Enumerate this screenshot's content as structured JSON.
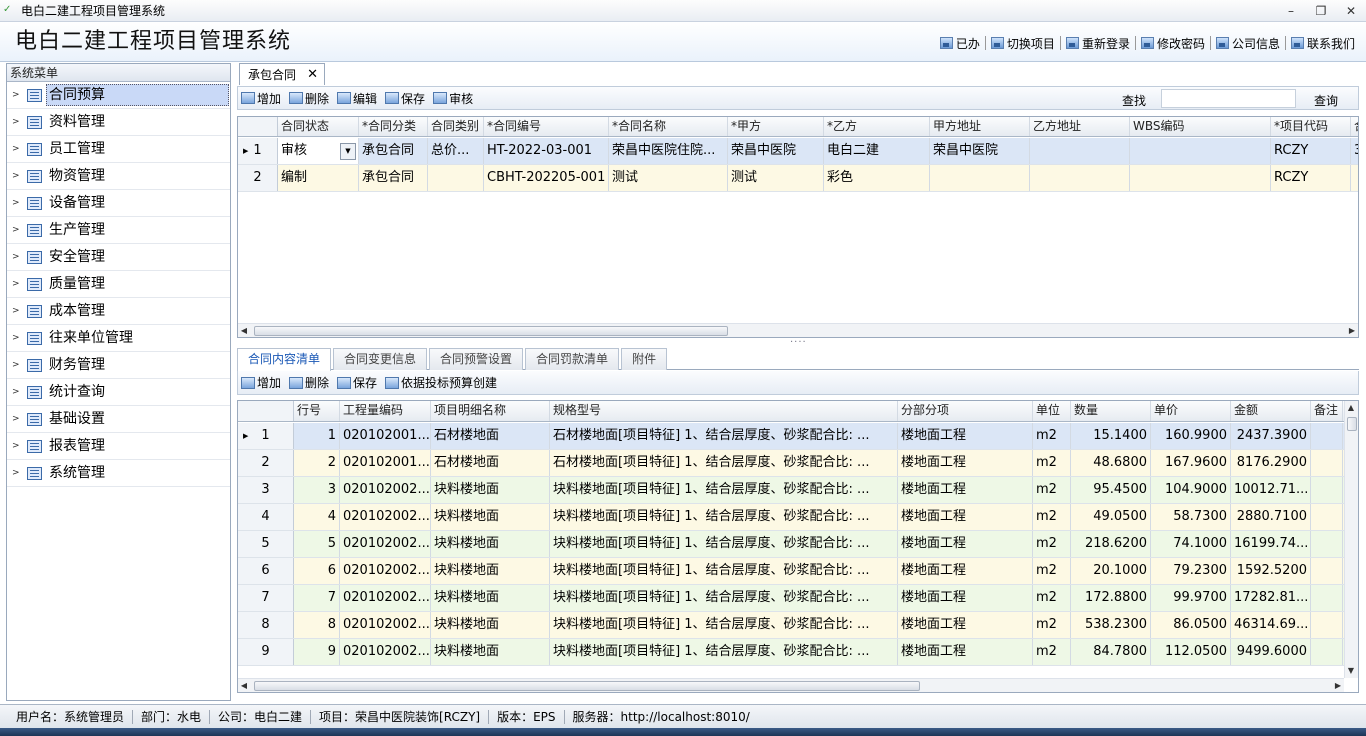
{
  "window": {
    "title": "电白二建工程项目管理系统"
  },
  "header": {
    "app_title": "电白二建工程项目管理系统",
    "links": [
      "已办",
      "切换项目",
      "重新登录",
      "修改密码",
      "公司信息",
      "联系我们"
    ]
  },
  "sidebar": {
    "title": "系统菜单",
    "items": [
      "合同预算",
      "资料管理",
      "员工管理",
      "物资管理",
      "设备管理",
      "生产管理",
      "安全管理",
      "质量管理",
      "成本管理",
      "往来单位管理",
      "财务管理",
      "统计查询",
      "基础设置",
      "报表管理",
      "系统管理"
    ]
  },
  "doc_tab": {
    "label": "承包合同",
    "close": "✕"
  },
  "top_toolbar": {
    "buttons": [
      "增加",
      "删除",
      "编辑",
      "保存",
      "审核"
    ],
    "search_label": "查找",
    "search_value": "",
    "query_button": "查询"
  },
  "contract_grid": {
    "columns": [
      "合同状态",
      "*合同分类",
      "合同类别",
      "*合同编号",
      "*合同名称",
      "*甲方",
      "*乙方",
      "甲方地址",
      "乙方地址",
      "WBS编码",
      "*项目代码",
      "合"
    ],
    "rows": [
      {
        "no": "1",
        "cells": [
          "审核",
          "承包合同",
          "总价...",
          "HT-2022-03-001",
          "荣昌中医院住院...",
          "荣昌中医院",
          "电白二建",
          "荣昌中医院",
          "",
          "",
          "RCZY",
          "3"
        ]
      },
      {
        "no": "2",
        "cells": [
          "编制",
          "承包合同",
          "",
          "CBHT-202205-001",
          "测试",
          "测试",
          "彩色",
          "",
          "",
          "",
          "RCZY",
          ""
        ]
      }
    ]
  },
  "sub_tabs": [
    "合同内容清单",
    "合同变更信息",
    "合同预警设置",
    "合同罚款清单",
    "附件"
  ],
  "sub_toolbar": {
    "buttons": [
      "增加",
      "删除",
      "保存",
      "依据投标预算创建"
    ]
  },
  "detail_grid": {
    "columns": [
      "行号",
      "工程量编码",
      "项目明细名称",
      "规格型号",
      "分部分项",
      "单位",
      "数量",
      "单价",
      "金额",
      "备注"
    ],
    "rows": [
      [
        "1",
        "020102001...",
        "石材楼地面",
        "石材楼地面[项目特征] 1、结合层厚度、砂浆配合比: ...",
        "楼地面工程",
        "m2",
        "15.1400",
        "160.9900",
        "2437.3900",
        ""
      ],
      [
        "2",
        "020102001...",
        "石材楼地面",
        "石材楼地面[项目特征] 1、结合层厚度、砂浆配合比: ...",
        "楼地面工程",
        "m2",
        "48.6800",
        "167.9600",
        "8176.2900",
        ""
      ],
      [
        "3",
        "020102002...",
        "块料楼地面",
        "块料楼地面[项目特征] 1、结合层厚度、砂浆配合比: ...",
        "楼地面工程",
        "m2",
        "95.4500",
        "104.9000",
        "10012.71...",
        ""
      ],
      [
        "4",
        "020102002...",
        "块料楼地面",
        "块料楼地面[项目特征] 1、结合层厚度、砂浆配合比: ...",
        "楼地面工程",
        "m2",
        "49.0500",
        "58.7300",
        "2880.7100",
        ""
      ],
      [
        "5",
        "020102002...",
        "块料楼地面",
        "块料楼地面[项目特征] 1、结合层厚度、砂浆配合比: ...",
        "楼地面工程",
        "m2",
        "218.6200",
        "74.1000",
        "16199.74...",
        ""
      ],
      [
        "6",
        "020102002...",
        "块料楼地面",
        "块料楼地面[项目特征] 1、结合层厚度、砂浆配合比: ...",
        "楼地面工程",
        "m2",
        "20.1000",
        "79.2300",
        "1592.5200",
        ""
      ],
      [
        "7",
        "020102002...",
        "块料楼地面",
        "块料楼地面[项目特征] 1、结合层厚度、砂浆配合比: ...",
        "楼地面工程",
        "m2",
        "172.8800",
        "99.9700",
        "17282.81...",
        ""
      ],
      [
        "8",
        "020102002...",
        "块料楼地面",
        "块料楼地面[项目特征] 1、结合层厚度、砂浆配合比: ...",
        "楼地面工程",
        "m2",
        "538.2300",
        "86.0500",
        "46314.69...",
        ""
      ],
      [
        "9",
        "020102002...",
        "块料楼地面",
        "块料楼地面[项目特征] 1、结合层厚度、砂浆配合比: ...",
        "楼地面工程",
        "m2",
        "84.7800",
        "112.0500",
        "9499.6000",
        ""
      ]
    ]
  },
  "statusbar": [
    "用户名：系统管理员",
    "部门：水电",
    "公司：电白二建",
    "项目：荣昌中医院装饰[RCZY]",
    "版本：EPS",
    "服务器：http://localhost:8010/"
  ]
}
